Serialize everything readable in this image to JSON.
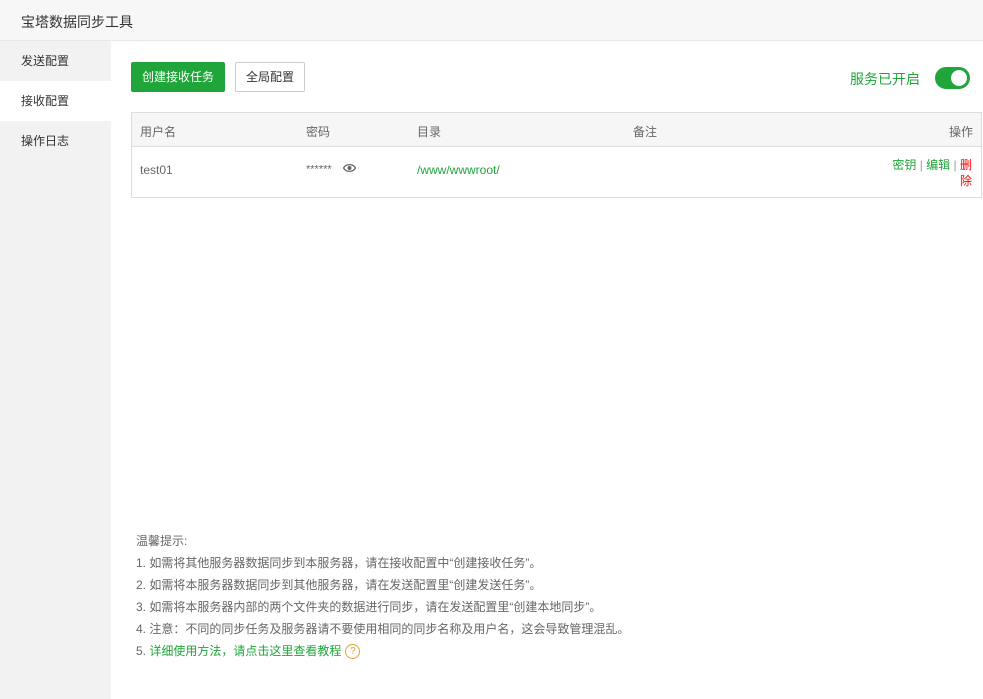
{
  "window": {
    "title": "宝塔数据同步工具"
  },
  "sidebar": {
    "items": [
      {
        "label": "发送配置",
        "active": false
      },
      {
        "label": "接收配置",
        "active": true
      },
      {
        "label": "操作日志",
        "active": false
      }
    ]
  },
  "toolbar": {
    "create_label": "创建接收任务",
    "global_label": "全局配置",
    "service_status": "服务已开启",
    "service_on": true
  },
  "table": {
    "headers": [
      "用户名",
      "密码",
      "目录",
      "备注",
      "操作"
    ],
    "rows": [
      {
        "username": "test01",
        "password": "******",
        "directory": "/www/wwwroot/",
        "note": "",
        "actions": {
          "key": "密钥",
          "edit": "编辑",
          "delete_line1": "删",
          "delete_line2": "除",
          "separator": "|"
        }
      }
    ]
  },
  "tips": {
    "heading": "温馨提示:",
    "lines": [
      "1. 如需将其他服务器数据同步到本服务器，请在接收配置中“创建接收任务”。",
      "2. 如需将本服务器数据同步到其他服务器，请在发送配置里“创建发送任务”。",
      "3. 如需将本服务器内部的两个文件夹的数据进行同步，请在发送配置里“创建本地同步”。",
      "4. 注意：不同的同步任务及服务器请不要使用相同的同步名称及用户名，这会导致管理混乱。"
    ],
    "line5_prefix": "5. ",
    "line5_link": "详细使用方法，请点击这里查看教程",
    "help_icon_glyph": "?"
  },
  "colors": {
    "accent": "#20a53a",
    "danger": "#ff0000",
    "hint": "#f0a020"
  }
}
